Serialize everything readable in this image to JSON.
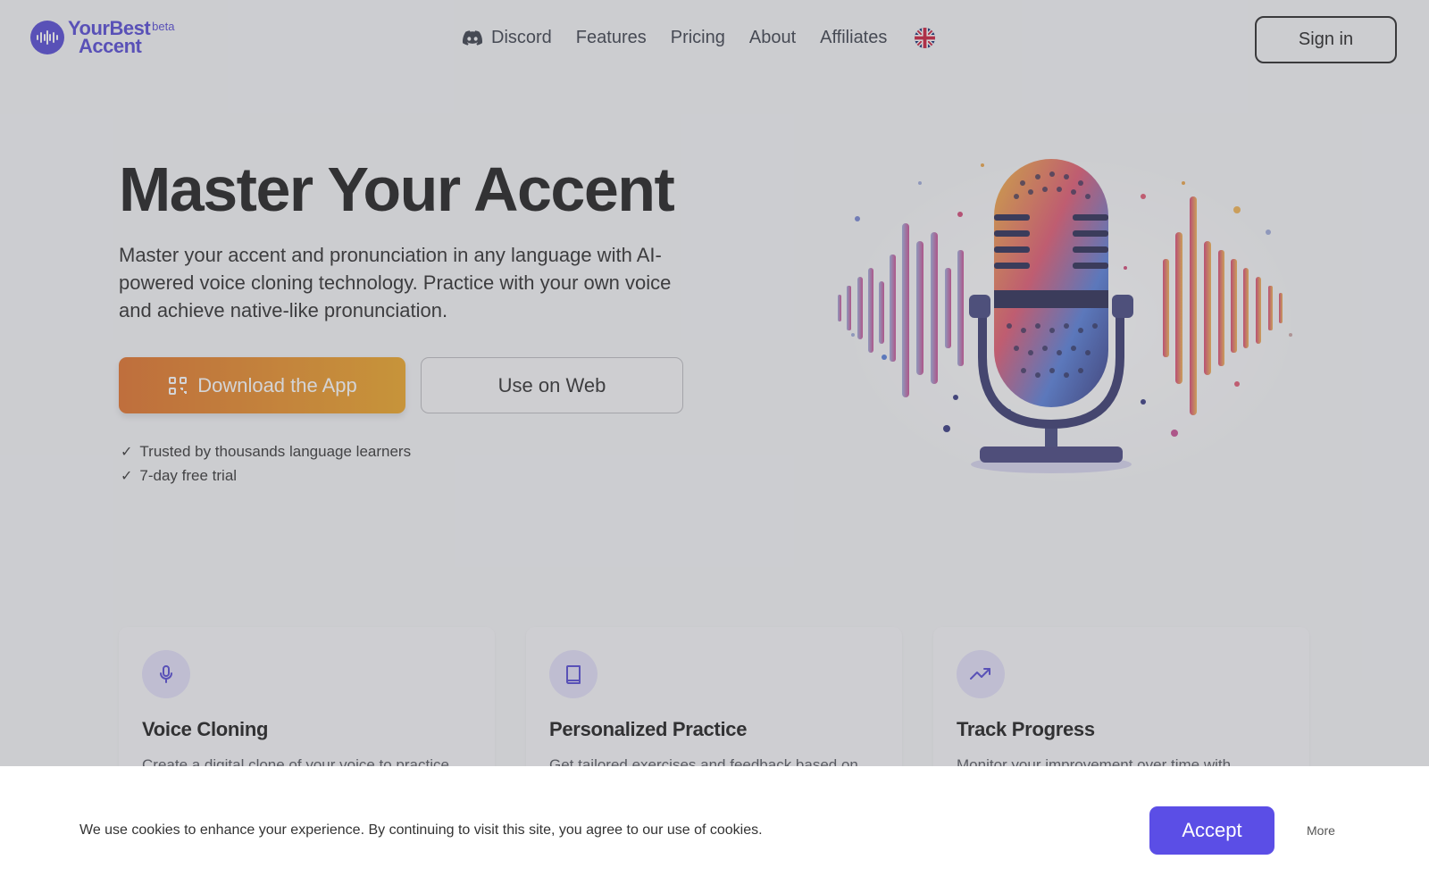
{
  "header": {
    "logo_line1": "YourBest",
    "logo_line2": "Accent",
    "logo_badge": "beta",
    "nav": [
      {
        "label": "Discord",
        "icon": "discord-icon"
      },
      {
        "label": "Features"
      },
      {
        "label": "Pricing"
      },
      {
        "label": "About"
      },
      {
        "label": "Affiliates"
      }
    ],
    "language_icon": "uk-flag-icon",
    "signin_label": "Sign in"
  },
  "hero": {
    "title": "Master Your Accent",
    "description": "Master your accent and pronunciation in any language with AI-powered voice cloning technology. Practice with your own voice and achieve native-like pronunciation.",
    "download_label": "Download the App",
    "download_icon": "qr-code-icon",
    "web_label": "Use on Web",
    "checks": [
      "Trusted by thousands language learners",
      "7-day free trial"
    ],
    "illustration": "microphone-soundwave-illustration"
  },
  "features": [
    {
      "icon": "microphone-icon",
      "title": "Voice Cloning",
      "description": "Create a digital clone of your voice to practice"
    },
    {
      "icon": "book-icon",
      "title": "Personalized Practice",
      "description": "Get tailored exercises and feedback based on"
    },
    {
      "icon": "trending-up-icon",
      "title": "Track Progress",
      "description": "Monitor your improvement over time with"
    }
  ],
  "cookie": {
    "text": "We use cookies to enhance your experience. By continuing to visit this site, you agree to our use of cookies.",
    "accept_label": "Accept",
    "more_label": "More"
  },
  "colors": {
    "brand": "#4b3fd1",
    "accept": "#5b4ee6",
    "download_gradient_start": "#e06a1e",
    "download_gradient_end": "#eca11a"
  }
}
